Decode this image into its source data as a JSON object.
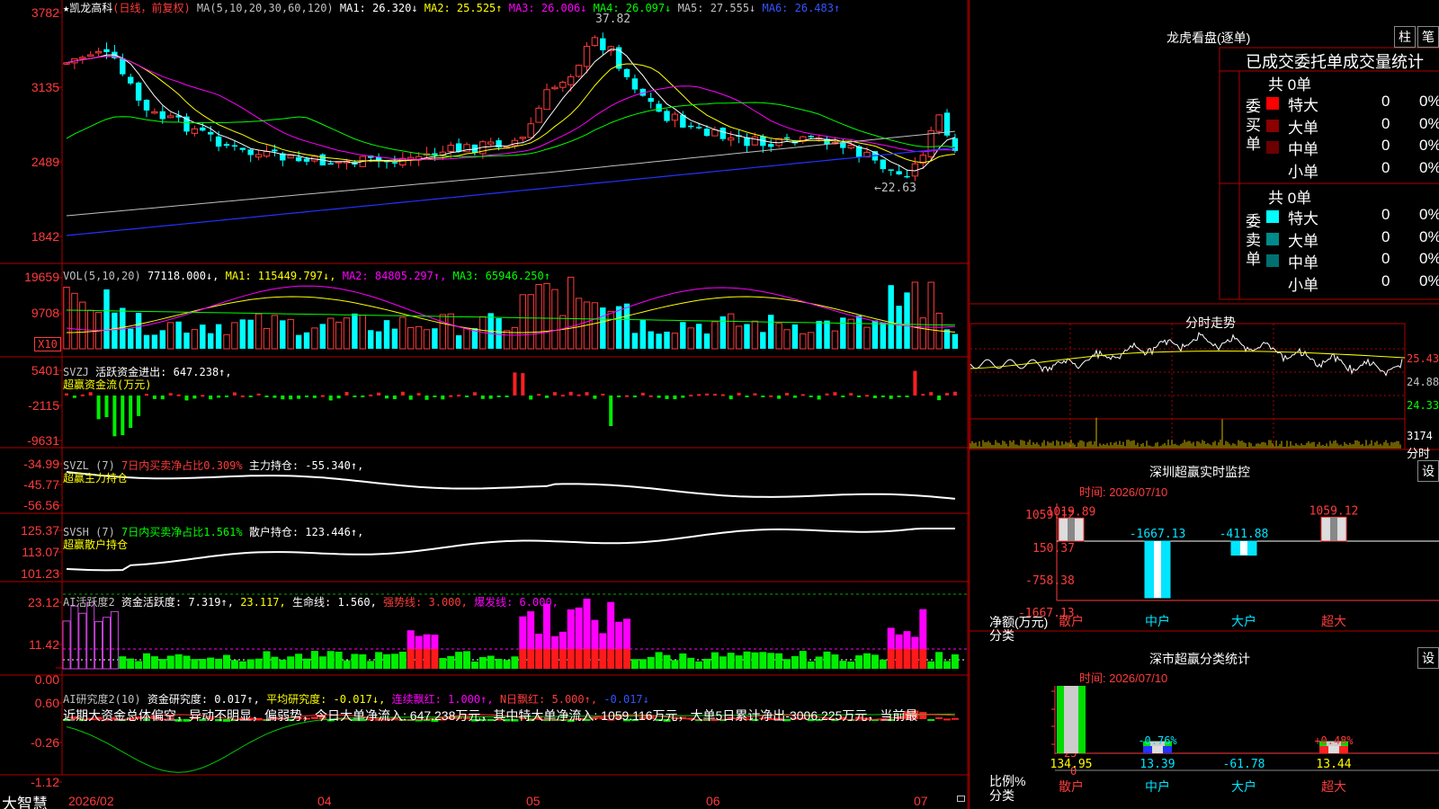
{
  "stock": {
    "name": "★凯龙高科",
    "mode": "(日线，前复权)",
    "ma_label": "MA(5,10,20,30,60,120)",
    "ma": [
      {
        "label": "MA1:",
        "value": "26.320↓",
        "color": "#ffffff"
      },
      {
        "label": "MA2:",
        "value": "25.525↑",
        "color": "#ffff00"
      },
      {
        "label": "MA3:",
        "value": "26.006↓",
        "color": "#ff00ff"
      },
      {
        "label": "MA4:",
        "value": "26.097↓",
        "color": "#00ff00"
      },
      {
        "label": "MA5:",
        "value": "27.555↓",
        "color": "#c0c0c0"
      },
      {
        "label": "MA6:",
        "value": "26.483↑",
        "color": "#3355ff"
      }
    ],
    "high_label": "37.82",
    "low_label": "←22.63"
  },
  "axes": {
    "price": [
      "3782",
      "3135",
      "2489",
      "1842"
    ],
    "vol": [
      "19659",
      "9708"
    ],
    "vol_unit": "X10",
    "svzj": [
      "5401",
      "-2115",
      "-9631"
    ],
    "svzl": [
      "-34.99",
      "-45.77",
      "-56.56"
    ],
    "svsh": [
      "125.37",
      "113.07",
      "101.23"
    ],
    "ai": [
      "23.12",
      "11.42",
      "0.00"
    ],
    "ai2": [
      "0.60",
      "-0.26",
      "-1.12"
    ]
  },
  "vol_legend": {
    "name": "VOL(5,10,20)",
    "val": "77118.000↓,",
    "ma1": "MA1: 115449.797↓,",
    "ma2": "MA2: 84805.297↑,",
    "ma3": "MA3: 65946.250↑"
  },
  "svzj_legend": {
    "name": "SVZJ",
    "text": "活跃资金进出: 647.238↑,",
    "sub": "超赢资金流(万元)"
  },
  "svzl_legend": {
    "name": "SVZL (7)",
    "pct": "7日内买卖净占比0.309%",
    "text": "主力持仓: -55.340↑,",
    "sub": "超赢主力持仓"
  },
  "svsh_legend": {
    "name": "SVSH (7)",
    "pct": "7日内买卖净占比1.561%",
    "text": "散户持仓: 123.446↑,",
    "sub": "超赢散户持仓"
  },
  "ai_legend": {
    "name": "AI活跃度2",
    "a": "资金活跃度: 7.319↑,",
    "b": "23.117,",
    "c": "生命线: 1.560,",
    "d": "强势线: 3.000,",
    "e": "爆发线: 6.000,"
  },
  "ai2_legend": {
    "name": "AI研究度2(10)",
    "a": "资金研究度: 0.017↑,",
    "b": "平均研究度: -0.017↓,",
    "c": "连续飘红: 1.000↑,",
    "d": "N日飘红: 5.000↑,",
    "e": "-0.017↓",
    "desc": "近期大资金总体偏空，异动不明显，偏弱势，今日大单净流入: 647.238万元，其中特大单净流入: 1059.116万元，大单5日累计净出-3006.225万元，当前最"
  },
  "xaxis": {
    "brand": "大智慧",
    "labels": [
      "2026/02",
      "04",
      "05",
      "06",
      "07"
    ]
  },
  "right": {
    "lhb_title": "龙虎看盘(逐单)",
    "btn_zhu": "柱",
    "btn_bi": "笔",
    "tabs_title": "已成交委托单成交量统计",
    "buy_group": "委买单",
    "sell_group": "委卖单",
    "buy_total": "共 0单",
    "sell_total": "共 0单",
    "buy_rows": [
      {
        "name": "特大",
        "num": "0",
        "pct": "0%",
        "color": "#ff0000"
      },
      {
        "name": "大单",
        "num": "0",
        "pct": "0%",
        "color": "#8b0000"
      },
      {
        "name": "中单",
        "num": "0",
        "pct": "0%",
        "color": "#6b0000"
      },
      {
        "name": "小单",
        "num": "0",
        "pct": "0%",
        "color": "#000000"
      }
    ],
    "sell_rows": [
      {
        "name": "特大",
        "num": "0",
        "pct": "0%",
        "color": "#00ffff"
      },
      {
        "name": "大单",
        "num": "0",
        "pct": "0%",
        "color": "#008b8b"
      },
      {
        "name": "中单",
        "num": "0",
        "pct": "0%",
        "color": "#007070"
      },
      {
        "name": "小单",
        "num": "0",
        "pct": "0%",
        "color": "#000000"
      }
    ],
    "fs_title": "分时走势",
    "fs_prices": [
      "25.43",
      "24.88",
      "24.33"
    ],
    "fs_vol": "3174",
    "fs_unit": "分时",
    "sz_title": "深圳超赢实时监控",
    "set_btn": "设",
    "sz_time": "时间: 2026/07/10",
    "sz_axis": [
      "1059.12",
      "150.37",
      "-758.38",
      "-1667.13"
    ],
    "sz_unit": "净额(万元)",
    "sz_cat_label": "分类",
    "sz_cats": [
      "散户",
      "中户",
      "大户",
      "超大"
    ],
    "sz_values": [
      "1019.89",
      "-1667.13",
      "-411.88",
      "1059.12"
    ],
    "ss_title": "深市超赢分类统计",
    "ss_time": "时间: 2026/07/10",
    "ss_axis": [
      "75",
      "50",
      "25",
      "0"
    ],
    "ss_unit": "比例%",
    "ss_cat_label": "分类",
    "ss_cats": [
      "散户",
      "中户",
      "大户",
      "超大"
    ],
    "ss_top": [
      "",
      "-0.76%",
      "",
      "+0.48%"
    ],
    "ss_bottom": [
      "134.95",
      "13.39",
      "-61.78",
      "13.44"
    ]
  },
  "chart_data": [
    {
      "type": "bar",
      "title": "深圳超赢实时监控",
      "categories": [
        "散户",
        "中户",
        "大户",
        "超大"
      ],
      "values": [
        1019.89,
        -1667.13,
        -411.88,
        1059.12
      ],
      "ylabel": "净额(万元)",
      "ylim": [
        -1667.13,
        1059.12
      ]
    },
    {
      "type": "bar",
      "title": "深市超赢分类统计",
      "categories": [
        "散户",
        "中户",
        "大户",
        "超大"
      ],
      "values": [
        134.95,
        13.39,
        -61.78,
        13.44
      ],
      "ylabel": "比例%",
      "ylim": [
        0,
        75
      ]
    }
  ]
}
